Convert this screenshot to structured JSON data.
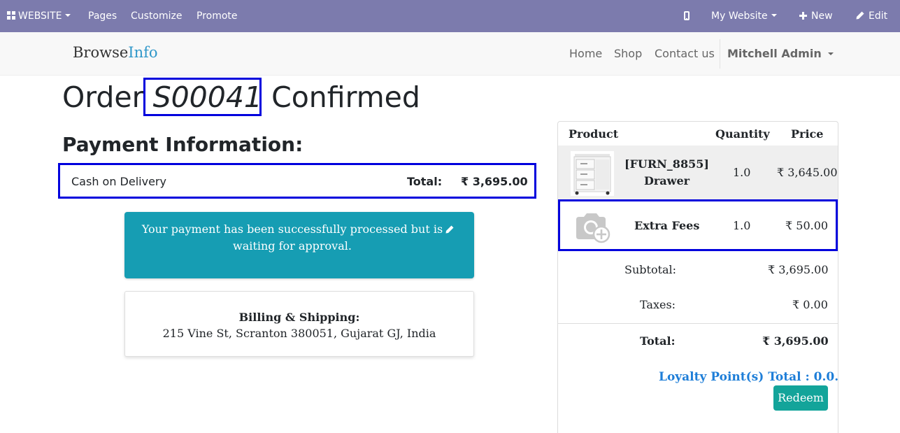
{
  "adminbar": {
    "app_label": "WEBSITE",
    "pages": "Pages",
    "customize": "Customize",
    "promote": "Promote",
    "website_switch": "My Website",
    "new_label": "New",
    "edit_label": "Edit",
    "bg_color": "#7c7bad"
  },
  "header": {
    "logo_part1": "Browse",
    "logo_part2": "Info",
    "nav": [
      "Home",
      "Shop",
      "Contact us"
    ],
    "user": "Mitchell Admin"
  },
  "order": {
    "title_prefix": "Order",
    "number": "S00041",
    "title_suffix": "Confirmed"
  },
  "payment": {
    "heading": "Payment Information:",
    "method": "Cash on Delivery",
    "total_label": "Total:",
    "total_value": "₹ 3,695.00"
  },
  "alert": {
    "message": "Your payment has been successfully processed but is waiting for approval.",
    "color": "#169db3"
  },
  "billing": {
    "heading": "Billing & Shipping:",
    "address": "215 Vine St, Scranton 380051, Gujarat GJ, India"
  },
  "summary": {
    "columns": [
      "Product",
      "Quantity",
      "Price"
    ],
    "lines": [
      {
        "name_line1": "[FURN_8855]",
        "name_line2": "Drawer",
        "quantity": "1.0",
        "price": "₹ 3,645.00",
        "image": "drawer-thumbnail"
      },
      {
        "name_line1": "Extra Fees",
        "quantity": "1.0",
        "price": "₹ 50.00",
        "image": "camera-add-icon"
      }
    ],
    "subtotal_label": "Subtotal:",
    "subtotal_value": "₹ 3,695.00",
    "taxes_label": "Taxes:",
    "taxes_value": "₹ 0.00",
    "total_label": "Total:",
    "total_value": "₹ 3,695.00",
    "loyalty": "Loyalty Point(s) Total : 0.0.",
    "redeem_label": "Redeem",
    "loyalty_color": "#1e7ed8",
    "redeem_color": "#13a49a"
  }
}
